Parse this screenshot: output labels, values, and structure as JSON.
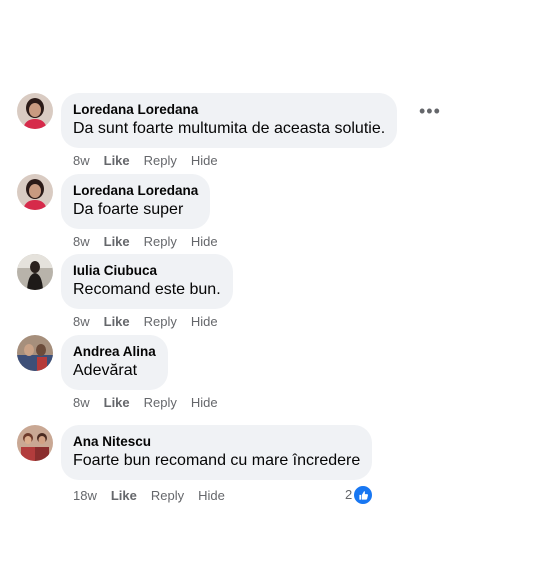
{
  "more_icon": "more-horizontal-icon",
  "comments": [
    {
      "author": "Loredana Loredana",
      "text": "Da sunt foarte multumita de aceasta solutie.",
      "time": "8w",
      "like": "Like",
      "reply": "Reply",
      "hide": "Hide"
    },
    {
      "author": "Loredana Loredana",
      "text": "Da foarte super",
      "time": "8w",
      "like": "Like",
      "reply": "Reply",
      "hide": "Hide"
    },
    {
      "author": "Iulia Ciubuca",
      "text": "Recomand este bun.",
      "time": "8w",
      "like": "Like",
      "reply": "Reply",
      "hide": "Hide"
    },
    {
      "author": "Andrea Alina",
      "text": "Adevărat",
      "time": "8w",
      "like": "Like",
      "reply": "Reply",
      "hide": "Hide"
    },
    {
      "author": "Ana Nitescu",
      "text": "Foarte bun recomand cu mare încredere",
      "time": "18w",
      "like": "Like",
      "reply": "Reply",
      "hide": "Hide",
      "reaction_count": "2",
      "reaction_icon": "thumbs-up-icon",
      "reaction_color": "#1877f2"
    }
  ]
}
